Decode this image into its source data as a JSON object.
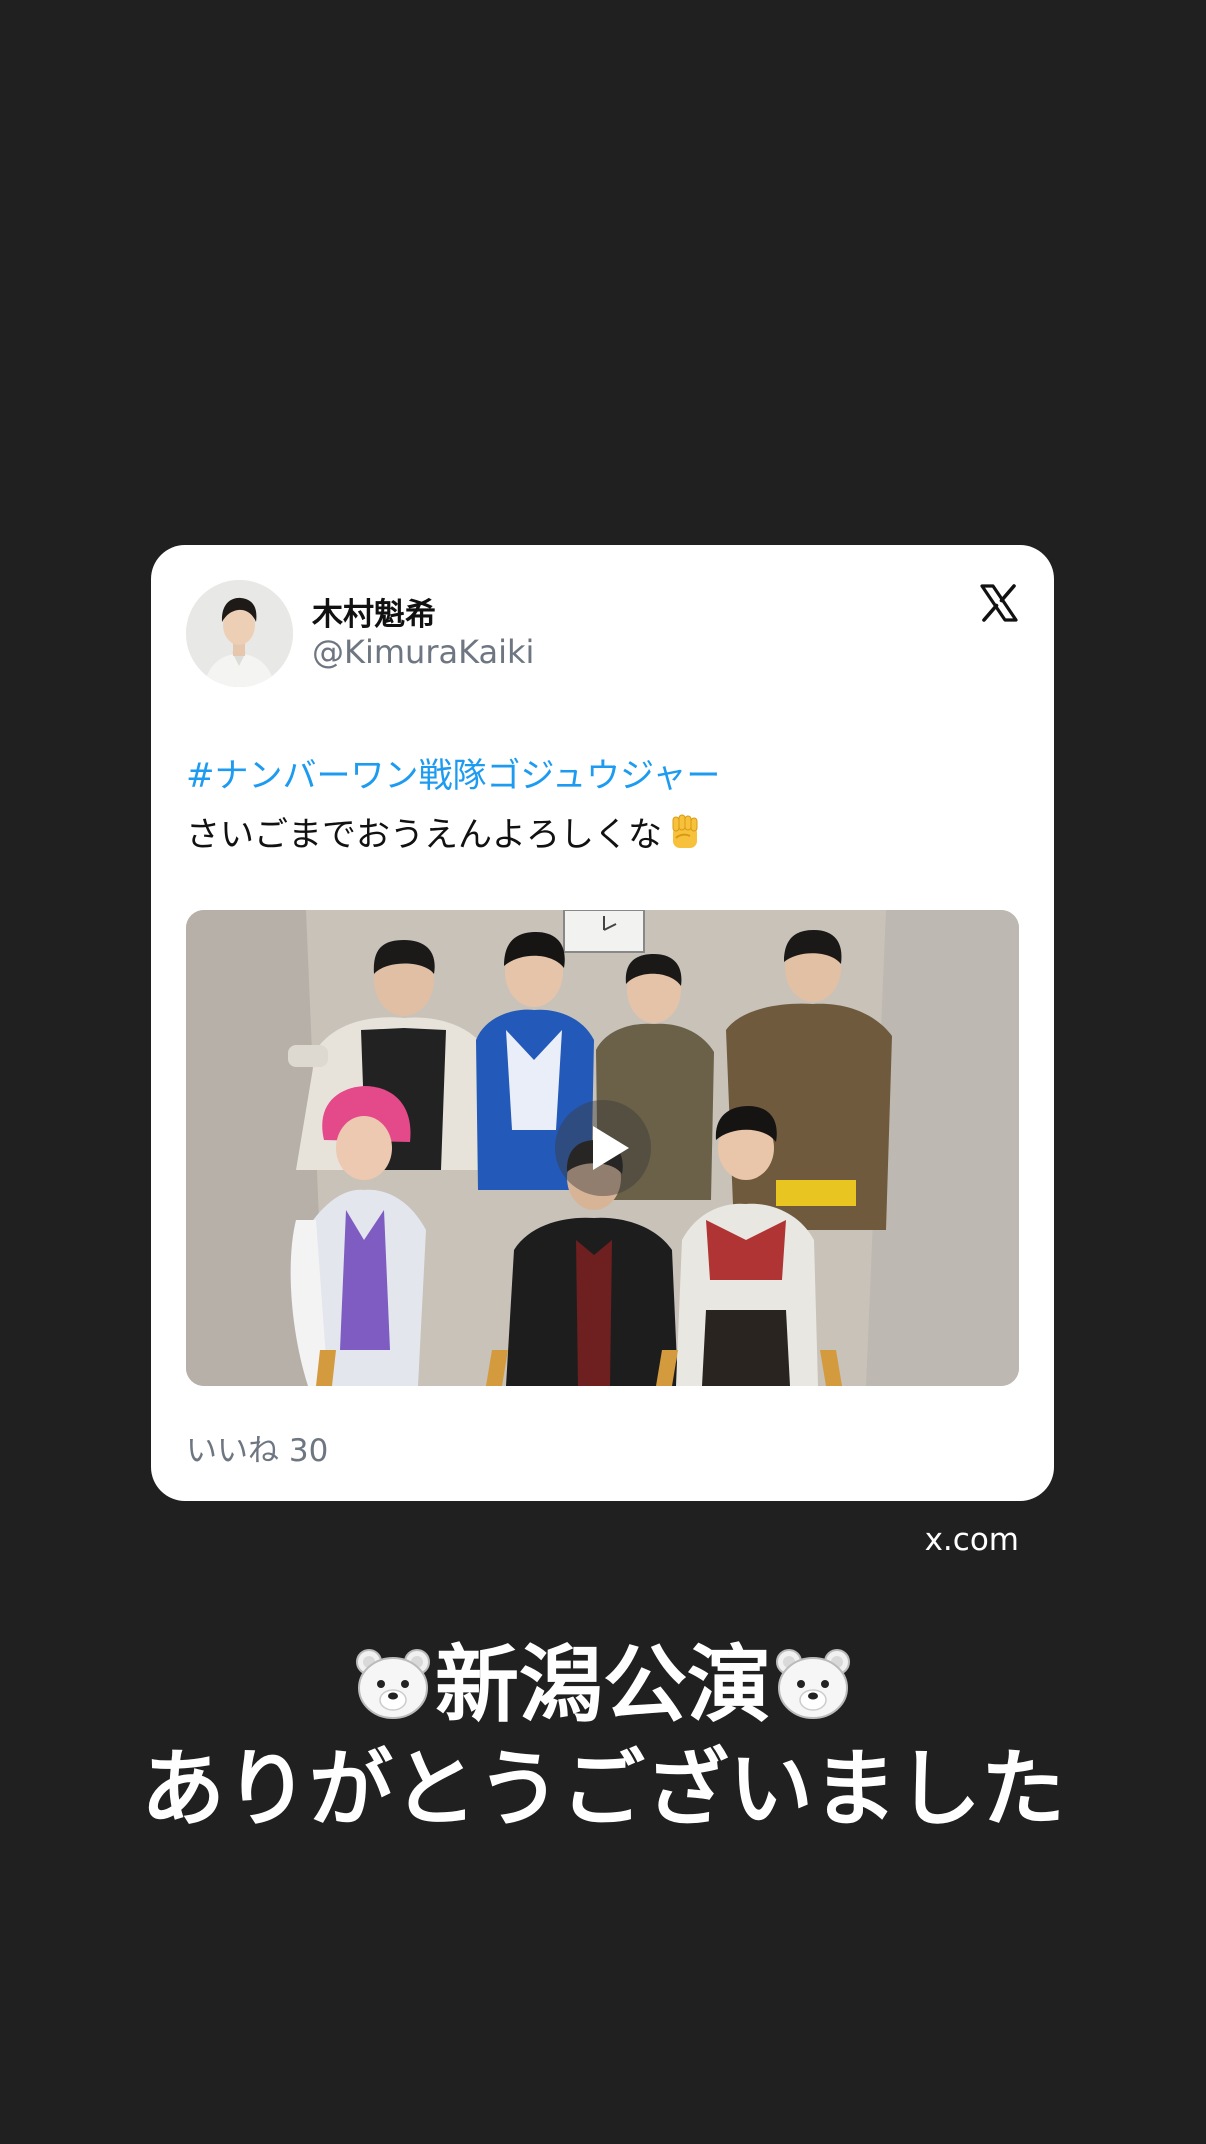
{
  "tweet": {
    "display_name": "木村魁希",
    "handle": "@KimuraKaiki",
    "hashtag": "#ナンバーワン戦隊ゴジュウジャー",
    "text": "さいごまでおうえんよろしくな",
    "text_emoji": "raised-fist",
    "media_type": "video",
    "likes_label": "いいね 30",
    "platform_icon": "x-logo-icon"
  },
  "source": "x.com",
  "caption": {
    "line1": "新潟公演",
    "line1_emoji": "polar-bear",
    "line2": "ありがとうございました"
  },
  "colors": {
    "background": "#202020",
    "card": "#ffffff",
    "hashtag": "#1d9bf0",
    "muted": "#6e7681"
  }
}
